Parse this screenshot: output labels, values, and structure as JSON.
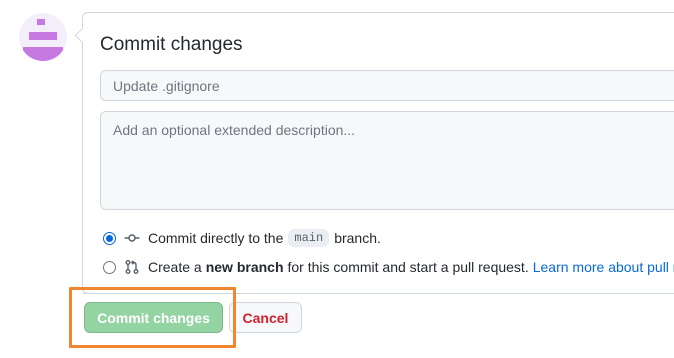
{
  "form": {
    "title": "Commit changes",
    "summary": {
      "value": "",
      "placeholder": "Update .gitignore"
    },
    "description": {
      "value": "",
      "placeholder": "Add an optional extended description..."
    }
  },
  "options": {
    "direct": {
      "selected": true,
      "text_before": "Commit directly to the",
      "branch": "main",
      "text_after": "branch.",
      "icon": "git-commit-icon"
    },
    "new_branch": {
      "selected": false,
      "text_before": "Create a",
      "emphasis": "new branch",
      "text_after": "for this commit and start a pull request.",
      "link": "Learn more about pull r",
      "icon": "git-pull-request-icon"
    }
  },
  "buttons": {
    "commit_label": "Commit changes",
    "cancel_label": "Cancel"
  },
  "colors": {
    "commit_button": "#94d3a2",
    "cancel_text": "#cf222e",
    "link": "#0969da",
    "highlight": "#f0862e",
    "avatar": "#c779e2"
  }
}
